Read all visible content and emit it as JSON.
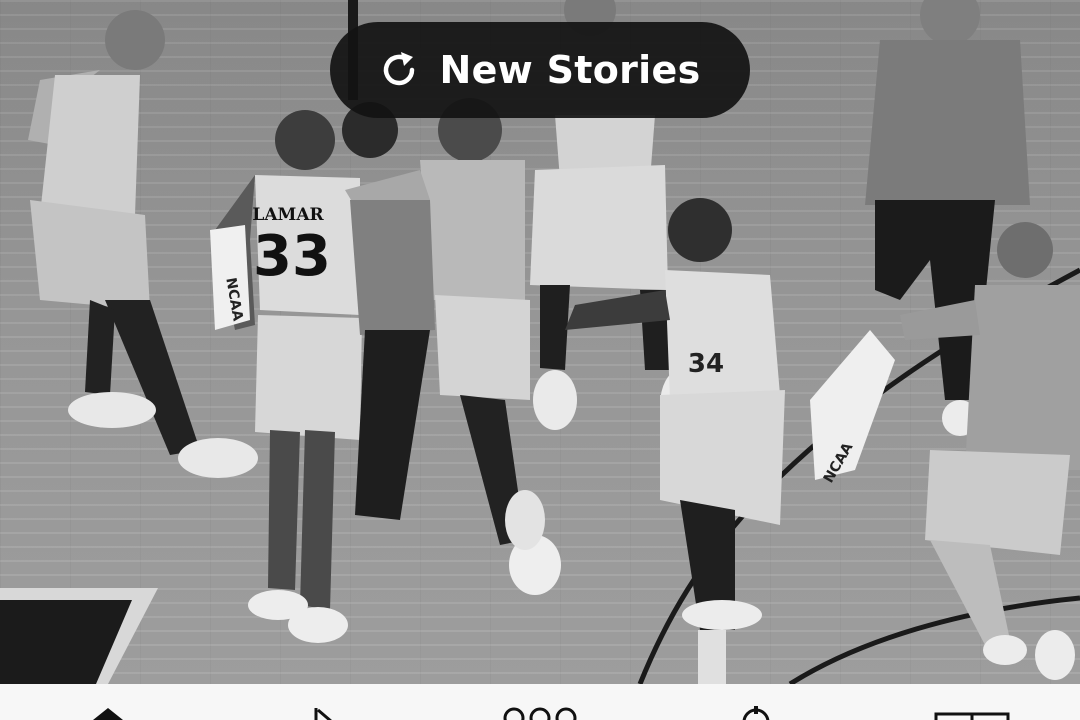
{
  "banner": {
    "label": "New Stories",
    "icon": "refresh-icon"
  },
  "photo": {
    "jersey_name": "LAMAR",
    "jersey_number": "33",
    "side_number": "34",
    "towel_text": "NCAA"
  },
  "bottom_nav": {
    "items": [
      {
        "icon": "home-icon"
      },
      {
        "icon": "sports-icon"
      },
      {
        "icon": "communities-icon"
      },
      {
        "icon": "location-icon"
      },
      {
        "icon": "sections-icon"
      }
    ]
  },
  "colors": {
    "banner_bg": "#121212",
    "banner_text": "#ffffff",
    "nav_bg": "#f7f7f7",
    "nav_icon": "#111111"
  }
}
